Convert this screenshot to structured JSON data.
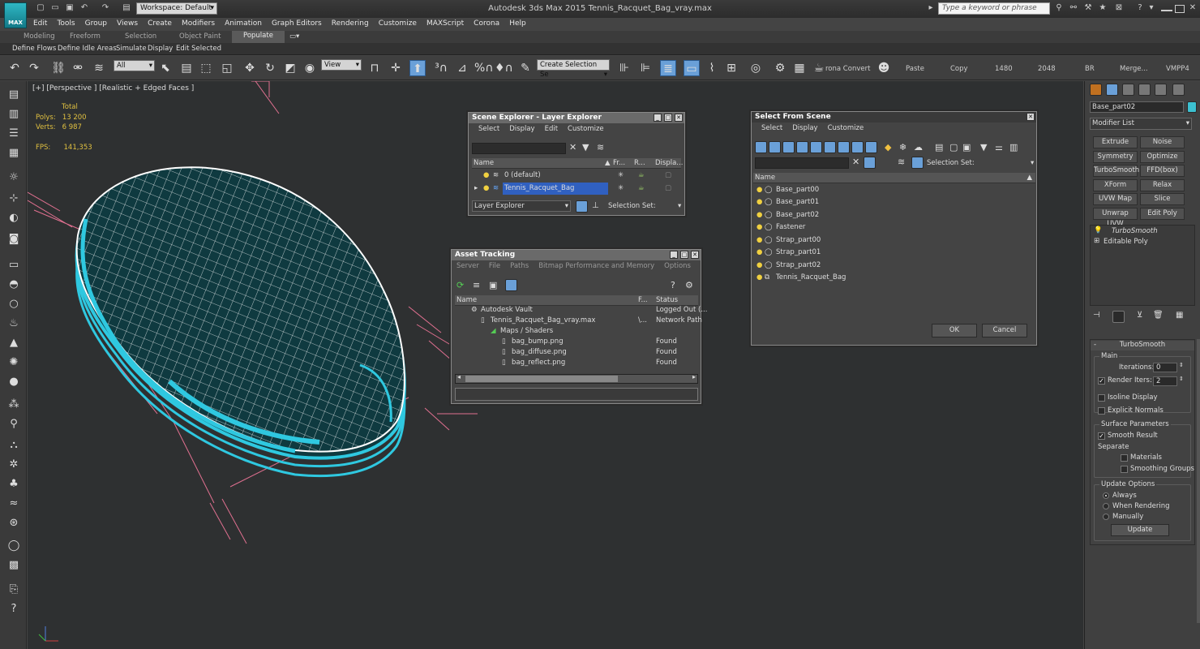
{
  "app": {
    "title": "Autodesk 3ds Max  2015    Tennis_Racquet_Bag_vray.max",
    "logo_text": "MAX",
    "workspace": "Workspace: Default",
    "search_placeholder": "Type a keyword or phrase"
  },
  "menu": [
    "Edit",
    "Tools",
    "Group",
    "Views",
    "Create",
    "Modifiers",
    "Animation",
    "Graph Editors",
    "Rendering",
    "Customize",
    "MAXScript",
    "Corona",
    "Help"
  ],
  "ribbon": {
    "tabs": [
      "Modeling",
      "Freeform",
      "Selection",
      "Object Paint",
      "Populate"
    ],
    "active_tab": "Populate",
    "sub": [
      "Define Flows",
      "Define Idle Areas",
      "Simulate",
      "Display",
      "Edit Selected"
    ]
  },
  "toolbar": {
    "filter": "All",
    "ref_coord": "View",
    "selection_set_placeholder": "Create Selection Se",
    "corona_convert": "rona Convert",
    "paste": "Paste",
    "copy": "Copy",
    "w": "1480",
    "h": "2048",
    "br": "BR",
    "merge": "Merge...",
    "vmpp": "VMPP4"
  },
  "viewport": {
    "label": "[+] [Perspective ] [Realistic + Edged Faces ]",
    "stats": {
      "total_label": "Total",
      "polys_label": "Polys:",
      "polys": "13 200",
      "verts_label": "Verts:",
      "verts": "6 987",
      "fps_label": "FPS:",
      "fps": "141,353"
    }
  },
  "scene_explorer": {
    "title": "Scene Explorer - Layer Explorer",
    "menu": [
      "Select",
      "Display",
      "Edit",
      "Customize"
    ],
    "columns": [
      "Name",
      "Fr...",
      "R...",
      "Displa..."
    ],
    "rows": [
      "0 (default)",
      "Tennis_Racquet_Bag"
    ],
    "mode": "Layer Explorer",
    "selection_set": "Selection Set:"
  },
  "asset_tracking": {
    "title": "Asset Tracking",
    "menu": [
      "Server",
      "File",
      "Paths",
      "Bitmap Performance and Memory",
      "Options"
    ],
    "columns": [
      "Name",
      "F...",
      "Status"
    ],
    "rows": [
      {
        "name": "Autodesk Vault",
        "f": "",
        "status": "Logged Out (..."
      },
      {
        "name": "Tennis_Racquet_Bag_vray.max",
        "f": "\\...",
        "status": "Network Path"
      },
      {
        "name": "Maps / Shaders",
        "f": "",
        "status": ""
      },
      {
        "name": "bag_bump.png",
        "f": "",
        "status": "Found"
      },
      {
        "name": "bag_diffuse.png",
        "f": "",
        "status": "Found"
      },
      {
        "name": "bag_reflect.png",
        "f": "",
        "status": "Found"
      }
    ]
  },
  "select_from_scene": {
    "title": "Select From Scene",
    "menu": [
      "Select",
      "Display",
      "Customize"
    ],
    "selection_set": "Selection Set:",
    "column": "Name",
    "rows": [
      "Base_part00",
      "Base_part01",
      "Base_part02",
      "Fastener",
      "Strap_part00",
      "Strap_part01",
      "Strap_part02",
      "Tennis_Racquet_Bag"
    ],
    "ok": "OK",
    "cancel": "Cancel"
  },
  "command_panel": {
    "object_name": "Base_part02",
    "modifier_list": "Modifier List",
    "buttons": [
      "Extrude",
      "Noise",
      "Symmetry",
      "Optimize",
      "TurboSmooth",
      "FFD(box)",
      "XForm",
      "Relax",
      "UVW Map",
      "Slice",
      "Unwrap UVW",
      "Edit Poly"
    ],
    "stack": [
      "TurboSmooth",
      "Editable Poly"
    ],
    "rollout_title": "TurboSmooth",
    "main_label": "Main",
    "iterations_label": "Iterations:",
    "iterations": "0",
    "render_iters_label": "Render Iters:",
    "render_iters": "2",
    "isoline": "Isoline Display",
    "explicit_normals": "Explicit Normals",
    "surface_params": "Surface Parameters",
    "smooth_result": "Smooth Result",
    "separate": "Separate",
    "materials": "Materials",
    "smoothing_groups": "Smoothing Groups",
    "update_options": "Update Options",
    "always": "Always",
    "when_rendering": "When Rendering",
    "manually": "Manually",
    "update": "Update"
  },
  "colors": {
    "wire": "#ffffff",
    "mesh_fill": "#0f3a40",
    "selection_cyan": "#2fc8e0",
    "bbox_pink": "#e07090",
    "stats_yellow": "#e0c040"
  }
}
